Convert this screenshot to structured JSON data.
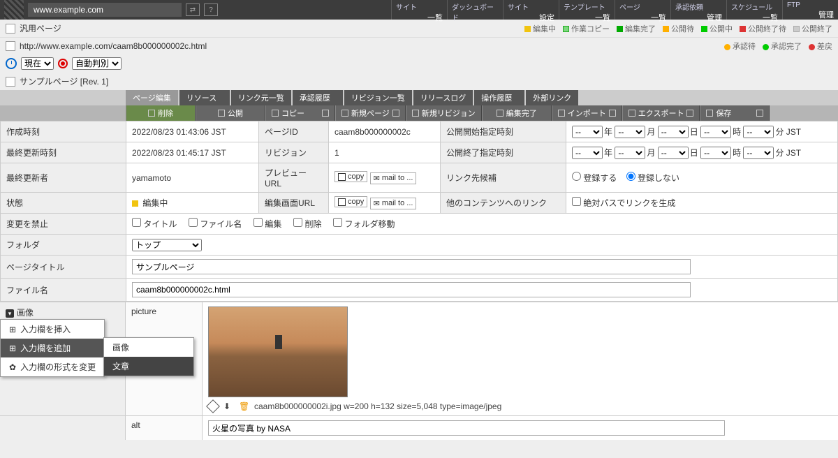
{
  "topbar": {
    "url": "www.example.com",
    "nav": [
      {
        "small": "サイト",
        "big": "一覧"
      },
      {
        "small": "ダッシュボード",
        "big": ""
      },
      {
        "small": "サイト",
        "big": "設定"
      },
      {
        "small": "テンプレート",
        "big": "一覧"
      },
      {
        "small": "ページ",
        "big": "一覧"
      },
      {
        "small": "承認依頼",
        "big": "管理"
      },
      {
        "small": "スケジュール",
        "big": "一覧"
      },
      {
        "small": "FTP",
        "big": "管理"
      }
    ]
  },
  "status_legend": [
    {
      "color": "sq-yellow",
      "label": "編集中"
    },
    {
      "color": "sq-lgreen",
      "label": "作業コピー"
    },
    {
      "color": "sq-dgreen",
      "label": "編集完了"
    },
    {
      "color": "sq-amber",
      "label": "公開待"
    },
    {
      "color": "sq-green2",
      "label": "公開中"
    },
    {
      "color": "sq-red",
      "label": "公開終了待"
    },
    {
      "color": "sq-pending",
      "label": "公開終了"
    }
  ],
  "approve_legend": [
    {
      "color": "sq-amber",
      "label": "承認待"
    },
    {
      "color": "sq-green2",
      "label": "承認完了"
    },
    {
      "color": "sq-red",
      "label": "差戻"
    }
  ],
  "page_type": "汎用ページ",
  "page_full_url": "http://www.example.com/caam8b000000002c.html",
  "time_current": "現在",
  "auto_detect": "自動判別",
  "breadcrumb": "サンプルページ [Rev. 1]",
  "tabs": [
    "ページ編集",
    "リソース",
    "リンク元一覧",
    "承認履歴",
    "リビジョン一覧",
    "リリースログ",
    "操作履歴",
    "外部リンク"
  ],
  "toolbar": [
    "削除",
    "公開",
    "コピー",
    "新規ページ",
    "新規リビジョン",
    "編集完了",
    "インポート",
    "エクスポート",
    "保存"
  ],
  "props": {
    "created_label": "作成時刻",
    "created_val": "2022/08/23 01:43:06 JST",
    "pageid_label": "ページID",
    "pageid_val": "caam8b000000002c",
    "pub_start_label": "公開開始指定時刻",
    "updated_label": "最終更新時刻",
    "updated_val": "2022/08/23 01:45:17 JST",
    "rev_label": "リビジョン",
    "rev_val": "1",
    "pub_end_label": "公開終了指定時刻",
    "updater_label": "最終更新者",
    "updater_val": "yamamoto",
    "preview_label": "プレビューURL",
    "copy": "copy",
    "mailto": "mail to ...",
    "linkcand_label": "リンク先候補",
    "reg_yes": "登録する",
    "reg_no": "登録しない",
    "status_label": "状態",
    "status_val": "編集中",
    "editurl_label": "編集画面URL",
    "otherlink_label": "他のコンテンツへのリンク",
    "abspath": "絶対パスでリンクを生成",
    "forbid_label": "変更を禁止",
    "forbid_title": "タイトル",
    "forbid_file": "ファイル名",
    "forbid_edit": "編集",
    "forbid_del": "削除",
    "forbid_move": "フォルダ移動",
    "folder_label": "フォルダ",
    "folder_val": "トップ",
    "title_label": "ページタイトル",
    "title_val": "サンプルページ",
    "filename_label": "ファイル名",
    "filename_val": "caam8b000000002c.html",
    "date_units": {
      "y": "年",
      "m": "月",
      "d": "日",
      "h": "時",
      "min": "分",
      "tz": "JST"
    }
  },
  "content": {
    "img_section": "画像",
    "picture_key": "picture",
    "file_info": "caam8b000000002i.jpg w=200 h=132 size=5,048 type=image/jpeg",
    "alt_key": "alt",
    "alt_val": "火星の写真 by NASA"
  },
  "context_menu": {
    "insert": "入力欄を挿入",
    "add": "入力欄を追加",
    "change": "入力欄の形式を変更",
    "sub_image": "画像",
    "sub_text": "文章"
  }
}
